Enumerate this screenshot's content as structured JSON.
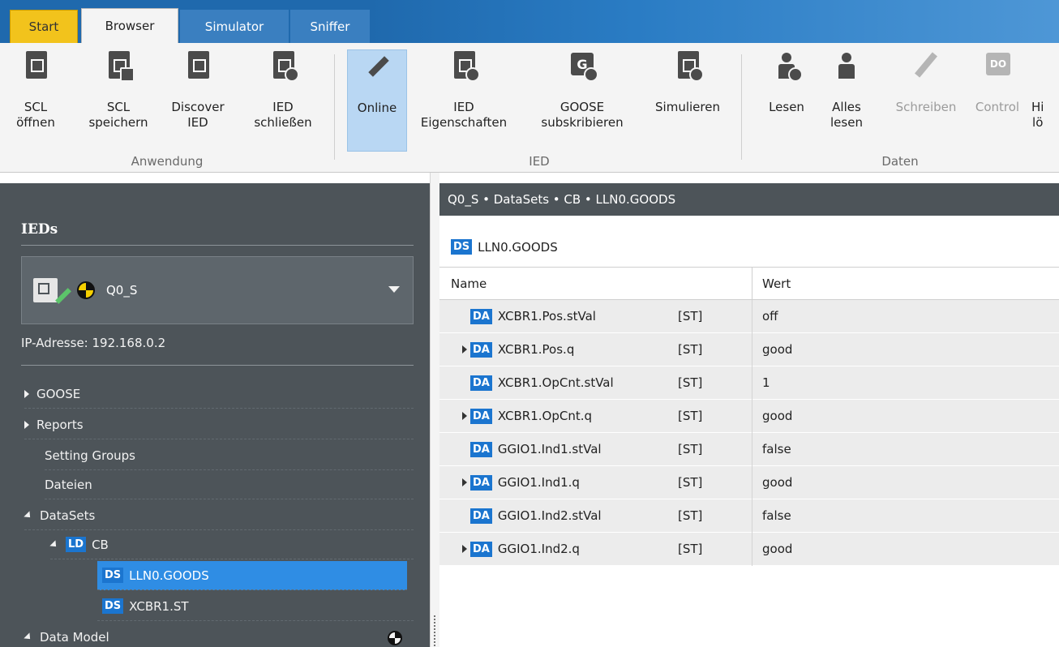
{
  "tabs": [
    {
      "label": "Start"
    },
    {
      "label": "Browser"
    },
    {
      "label": "Simulator"
    },
    {
      "label": "Sniffer"
    }
  ],
  "ribbon": {
    "scl_open": "SCL\nöffnen",
    "scl_save": "SCL\nspeichern",
    "discover_ied": "Discover\nIED",
    "ied_close": "IED\nschließen",
    "online": "Online",
    "ied_properties": "IED\nEigenschaften",
    "goose_subscribe": "GOOSE\nsubskribieren",
    "simulate": "Simulieren",
    "read": "Lesen",
    "read_all": "Alles\nlesen",
    "write": "Schreiben",
    "control": "Control",
    "more": "Hi\nlö",
    "group_application": "Anwendung",
    "group_ied": "IED",
    "group_data": "Daten"
  },
  "left": {
    "title": "IEDs",
    "selected_ied": "Q0_S",
    "ip_label": "IP-Adresse: 192.168.0.2",
    "tree": {
      "goose": "GOOSE",
      "reports": "Reports",
      "setting_groups": "Setting Groups",
      "files": "Dateien",
      "datasets": "DataSets",
      "ld_tag": "LD",
      "ld_name": "CB",
      "ds_tag": "DS",
      "ds1": "LLN0.GOODS",
      "ds2": "XCBR1.ST",
      "data_model": "Data Model"
    }
  },
  "main": {
    "breadcrumb": "Q0_S • DataSets • CB • LLN0.GOODS",
    "dataset_tag": "DS",
    "dataset_name": "LLN0.GOODS",
    "col_name": "Name",
    "col_value": "Wert",
    "da_tag": "DA",
    "rows": [
      {
        "name": "XCBR1.Pos.stVal",
        "fc": "[ST]",
        "value": "off"
      },
      {
        "name": "XCBR1.Pos.q",
        "fc": "[ST]",
        "value": "good"
      },
      {
        "name": "XCBR1.OpCnt.stVal",
        "fc": "[ST]",
        "value": "1"
      },
      {
        "name": "XCBR1.OpCnt.q",
        "fc": "[ST]",
        "value": "good"
      },
      {
        "name": "GGIO1.Ind1.stVal",
        "fc": "[ST]",
        "value": "false"
      },
      {
        "name": "GGIO1.Ind1.q",
        "fc": "[ST]",
        "value": "good"
      },
      {
        "name": "GGIO1.Ind2.stVal",
        "fc": "[ST]",
        "value": "false"
      },
      {
        "name": "GGIO1.Ind2.q",
        "fc": "[ST]",
        "value": "good"
      }
    ]
  }
}
